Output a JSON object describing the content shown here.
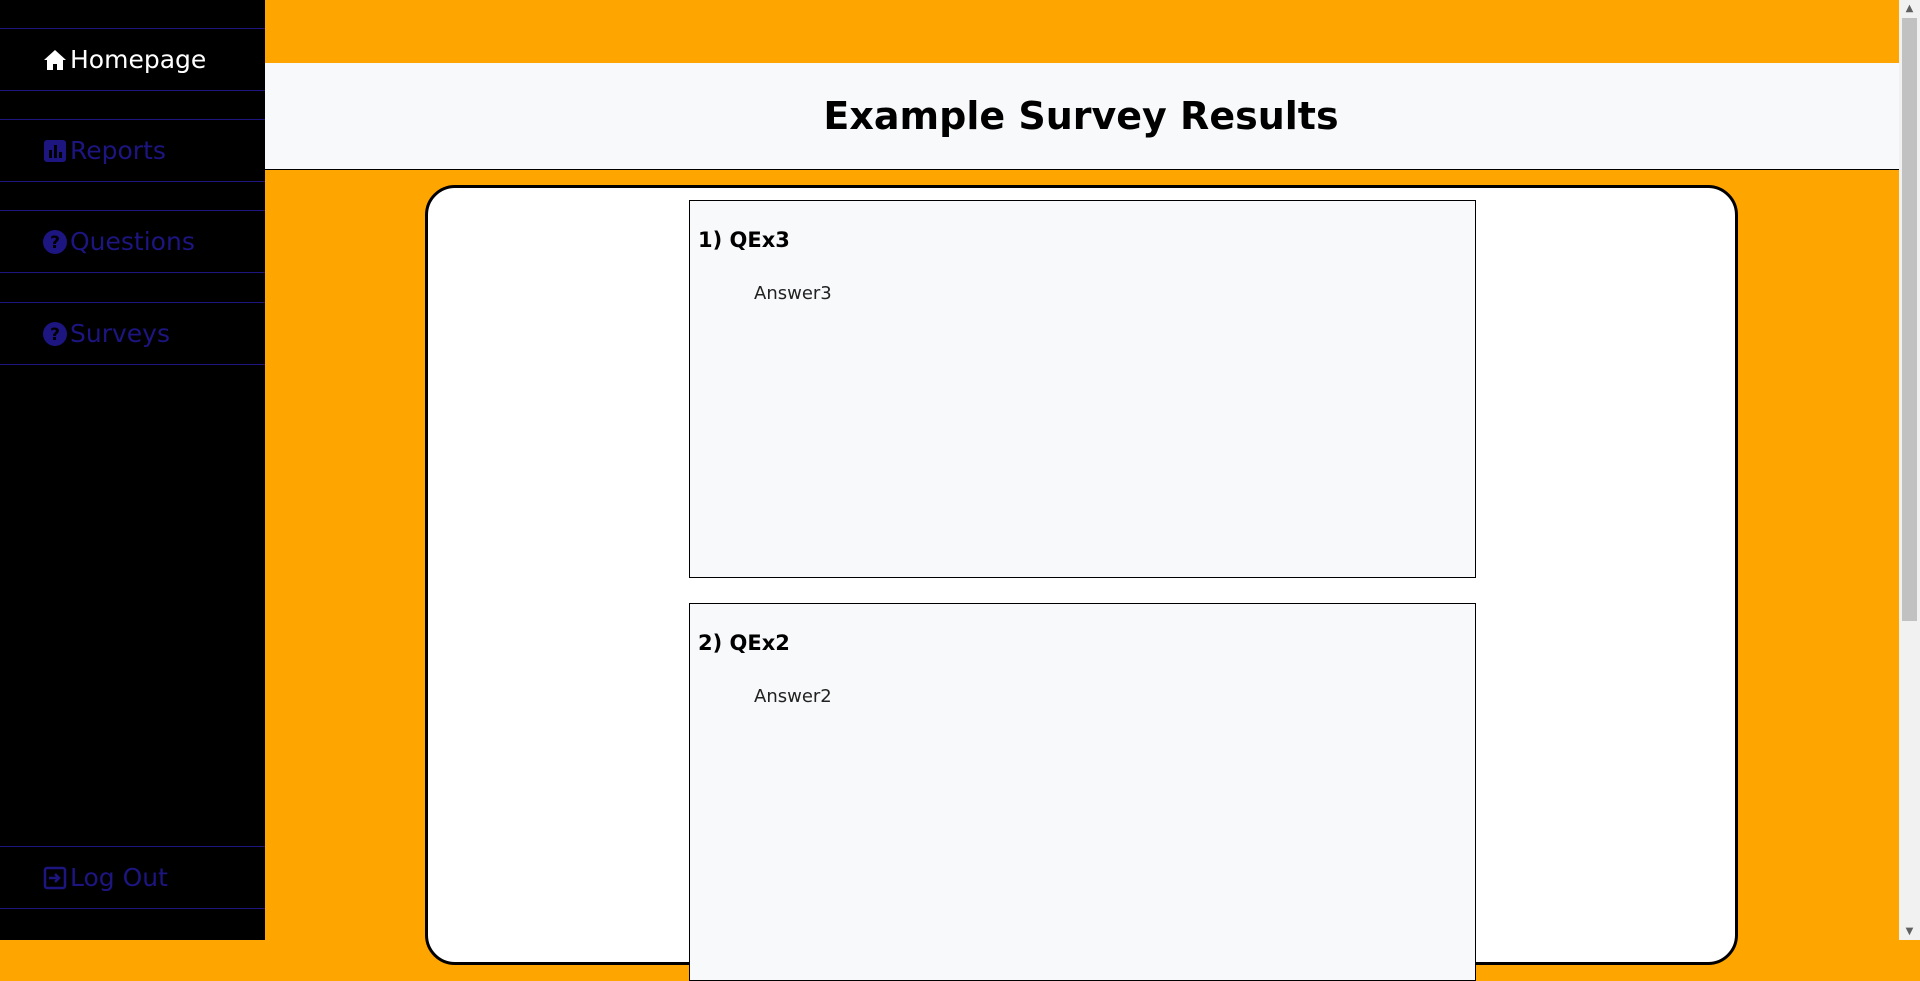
{
  "sidebar": {
    "items": [
      {
        "label": "Homepage",
        "icon": "home-icon"
      },
      {
        "label": "Reports",
        "icon": "bar-chart-icon"
      },
      {
        "label": "Questions",
        "icon": "question-circle-icon"
      },
      {
        "label": "Surveys",
        "icon": "question-circle-icon"
      }
    ],
    "logout": {
      "label": "Log Out",
      "icon": "logout-icon"
    }
  },
  "header": {
    "title": "Example Survey Results"
  },
  "questions": [
    {
      "title": "1) QEx3",
      "answer": "Answer3"
    },
    {
      "title": "2) QEx2",
      "answer": "Answer2"
    }
  ],
  "colors": {
    "accent": "#ffa500",
    "sidebar_bg": "#000000",
    "nav_dim": "#1d1580",
    "header_bg": "#f8f9fa"
  }
}
